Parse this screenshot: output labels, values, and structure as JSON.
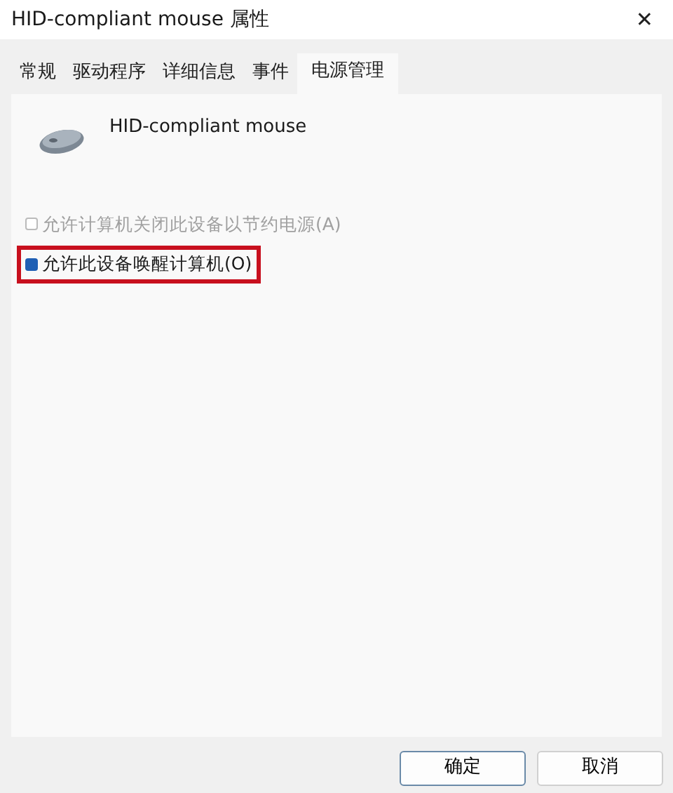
{
  "window": {
    "title": "HID-compliant mouse 属性",
    "close": "✕"
  },
  "tabs": [
    {
      "label": "常规",
      "selected": false
    },
    {
      "label": "驱动程序",
      "selected": false
    },
    {
      "label": "详细信息",
      "selected": false
    },
    {
      "label": "事件",
      "selected": false
    },
    {
      "label": "电源管理",
      "selected": true
    }
  ],
  "device": {
    "name": "HID-compliant mouse"
  },
  "options": [
    {
      "label": "允许计算机关闭此设备以节约电源(A)",
      "checked": false,
      "disabled": true,
      "highlighted": false
    },
    {
      "label": "允许此设备唤醒计算机(O)",
      "checked": true,
      "disabled": false,
      "highlighted": true
    }
  ],
  "buttons": [
    {
      "label": "确定",
      "default": true
    },
    {
      "label": "取消",
      "default": false
    }
  ]
}
